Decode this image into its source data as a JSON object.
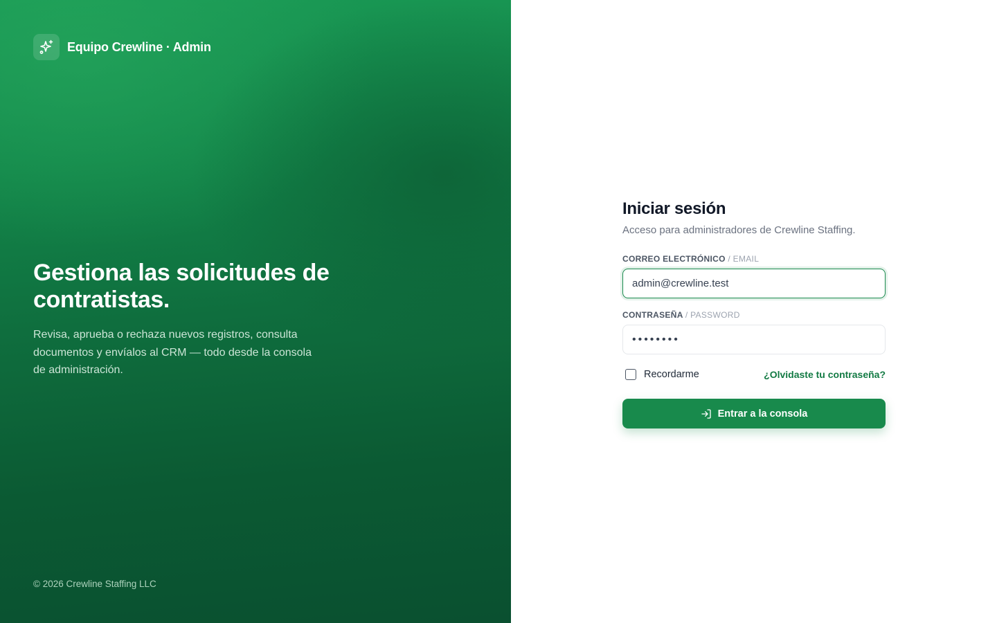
{
  "brand": {
    "name": "Equipo Crewline · Admin",
    "logo_icon": "sparkles-icon"
  },
  "hero": {
    "title": "Gestiona las solicitudes de contratistas.",
    "description": "Revisa, aprueba o rechaza nuevos registros, consulta documentos y envíalos al CRM — todo desde la consola de administración."
  },
  "footer": {
    "copyright": "© 2026 Crewline Staffing LLC"
  },
  "login": {
    "title": "Iniciar sesión",
    "subtitle": "Acceso para administradores de Crewline Staffing.",
    "email_label": "CORREO ELECTRÓNICO",
    "email_label_alt": "/ EMAIL",
    "email_value": "admin@crewline.test",
    "password_label": "CONTRASEÑA",
    "password_label_alt": "/ PASSWORD",
    "password_value": "••••••••",
    "remember_label": "Recordarme",
    "forgot_link": "¿Olvidaste tu contraseña?",
    "submit_label": "Entrar a la consola",
    "submit_icon": "log-in-icon"
  },
  "colors": {
    "brand_green": "#188a4c",
    "link_green": "#127a43",
    "panel_dark": "#0a5030"
  }
}
